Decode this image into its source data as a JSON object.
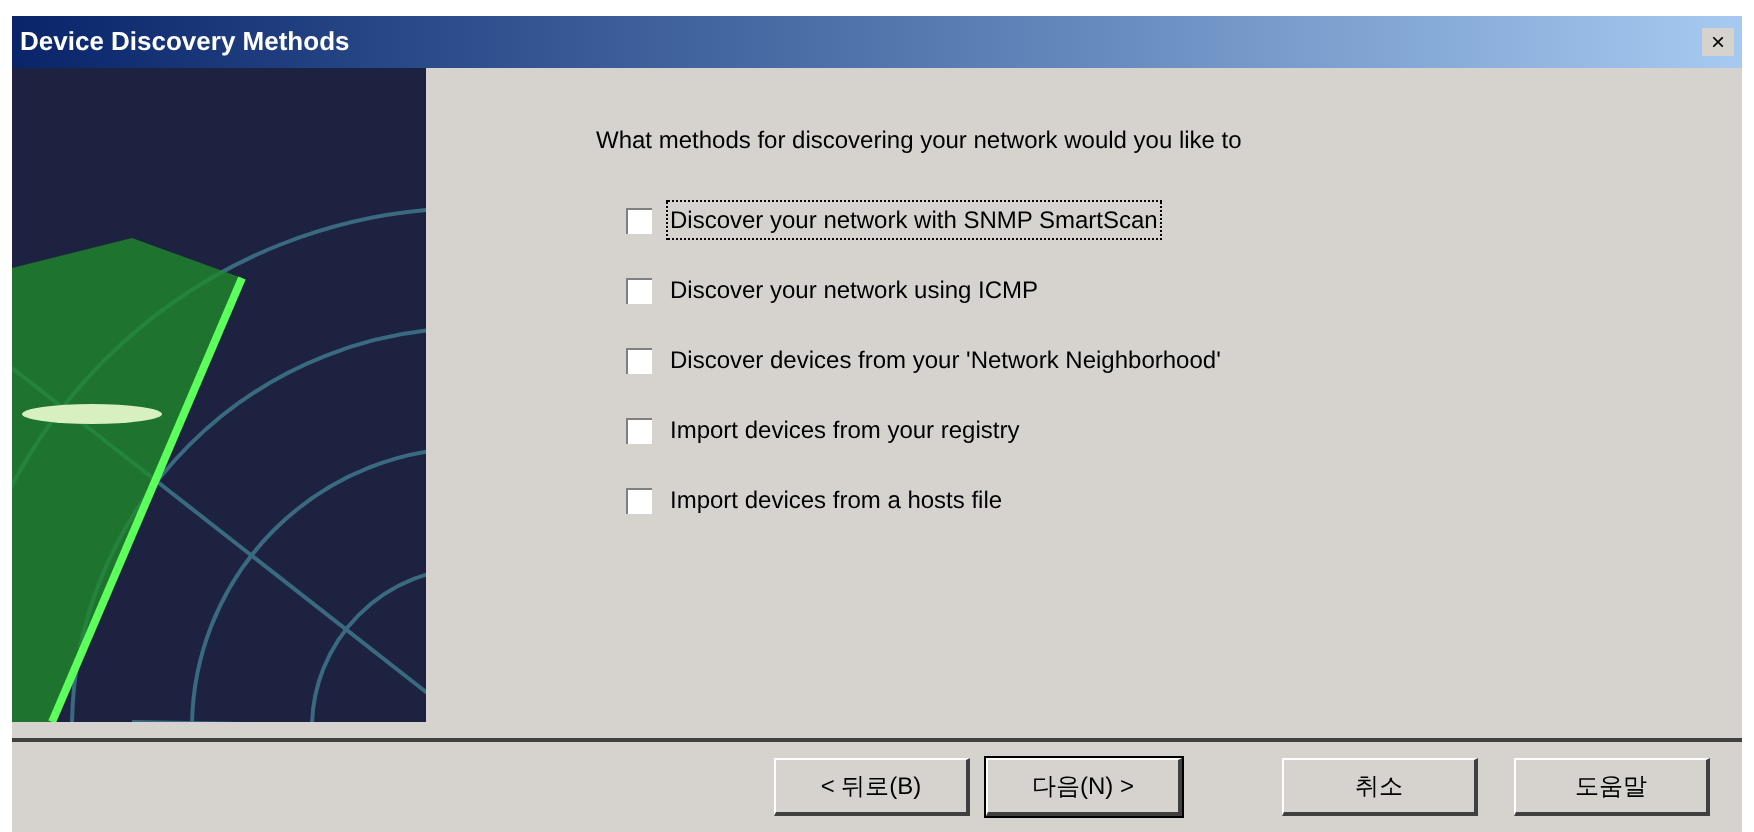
{
  "window": {
    "title": "Device Discovery Methods",
    "close": "×"
  },
  "prompt": "What methods for discovering your network would you like to",
  "options": [
    {
      "label": "Discover your network with SNMP SmartScan",
      "checked": false,
      "focused": true
    },
    {
      "label": "Discover your network using ICMP",
      "checked": false,
      "focused": false
    },
    {
      "label": "Discover devices from your 'Network Neighborhood'",
      "checked": false,
      "focused": false
    },
    {
      "label": "Import devices from your registry",
      "checked": false,
      "focused": false
    },
    {
      "label": "Import devices from a hosts file",
      "checked": false,
      "focused": false
    }
  ],
  "buttons": [
    {
      "label": "< 뒤로(B)",
      "default": false
    },
    {
      "label": "다음(N) >",
      "default": true
    },
    {
      "label": "취소",
      "default": false
    },
    {
      "label": "도움말",
      "default": false
    }
  ]
}
